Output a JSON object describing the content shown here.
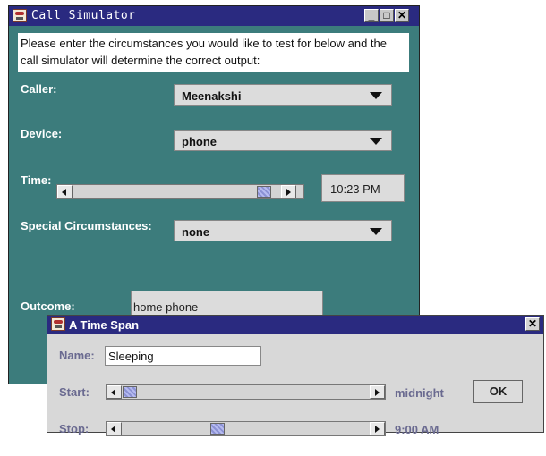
{
  "main_window": {
    "title": "Call Simulator",
    "window_buttons": {
      "minimize": "_",
      "maximize": "□",
      "close": "✕"
    },
    "intro_text": "Please enter the circumstances you would like to test for below and the call simulator will determine the correct output:",
    "caller": {
      "label": "Caller:",
      "value": "Meenakshi"
    },
    "device": {
      "label": "Device:",
      "value": "phone"
    },
    "time": {
      "label": "Time:",
      "value": "10:23 PM"
    },
    "special": {
      "label": "Special Circumstances:",
      "value": "none"
    },
    "outcome": {
      "label": "Outcome:",
      "value": "home phone"
    }
  },
  "dialog": {
    "title": "A Time Span",
    "close": "✕",
    "name": {
      "label": "Name:",
      "value": "Sleeping"
    },
    "start": {
      "label": "Start:",
      "value": "midnight"
    },
    "stop": {
      "label": "Stop:",
      "value": "9:00 AM"
    },
    "ok_label": "OK"
  },
  "icons": {
    "app": "java-coffee-cup-icon",
    "dropdown": "chevron-down-icon",
    "scroll_left": "arrow-left-icon",
    "scroll_right": "arrow-right-icon"
  },
  "colors": {
    "window_bg": "#3c7c7c",
    "titlebar_bg": "#2a2a80",
    "dialog_bg": "#d8d8d8",
    "dialog_label": "#6a6a90",
    "thumb": "#9ea4e0"
  }
}
